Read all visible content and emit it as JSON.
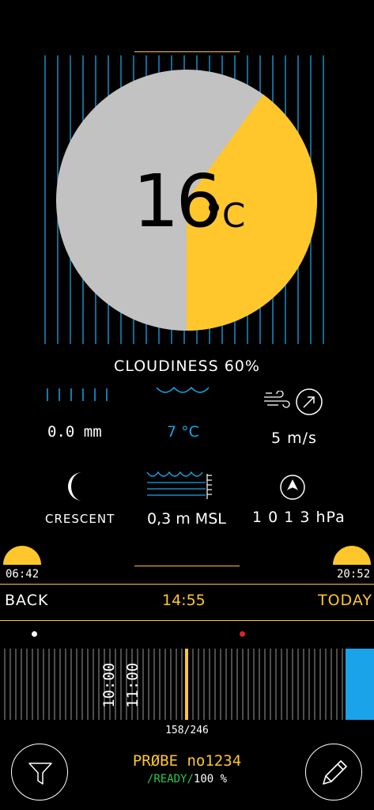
{
  "temperature": {
    "value": "16",
    "unit": "°C"
  },
  "cloudiness": {
    "label": "CLOUDINESS 60%",
    "percent": 60
  },
  "precipitation": {
    "value": "0.0 mm",
    "icon": "rain-lines-icon"
  },
  "water_temp": {
    "value": "7 °C",
    "icon": "waves-icon"
  },
  "wind": {
    "value": "5 m/s",
    "icon": "wind-icon",
    "direction_icon": "arrow-north-east-icon"
  },
  "moon": {
    "label": "CRESCENT",
    "icon": "crescent-moon-icon"
  },
  "sea_level": {
    "value": "0,3 m MSL",
    "icon": "tide-gauge-icon"
  },
  "pressure": {
    "value": "1 0 1 3 hPa",
    "icon": "pressure-gauge-icon"
  },
  "sun": {
    "sunrise": "06:42",
    "sunset": "20:52"
  },
  "nav": {
    "back": "BACK",
    "time": "14:55",
    "today": "TODAY"
  },
  "timeline": {
    "label_10": "10:00",
    "label_11": "11:00",
    "counter": "158/246"
  },
  "probe": {
    "name": "PRØBE no1234",
    "status": "/READY/",
    "battery": "100 %"
  },
  "colors": {
    "accent": "#ffc72c",
    "blue": "#1aa3e8",
    "grey": "#c2c2c2",
    "green": "#2fc64a",
    "red": "#e0202a"
  }
}
